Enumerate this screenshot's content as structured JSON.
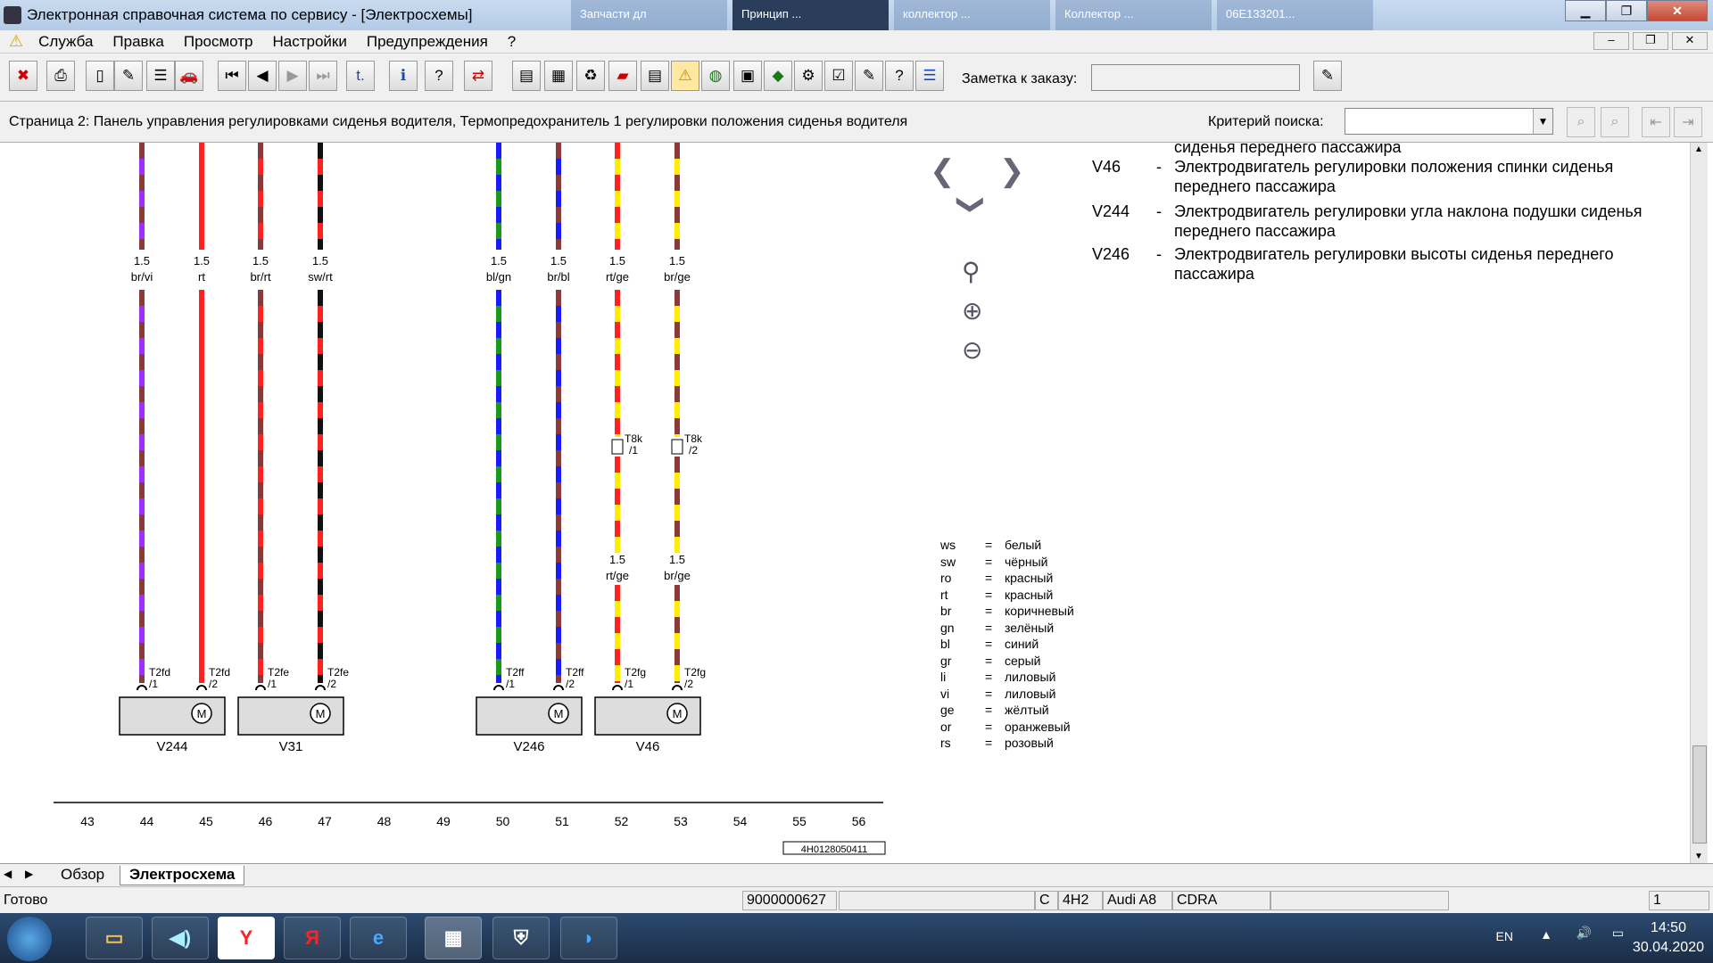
{
  "window": {
    "title": "Электронная справочная система по сервису - [Электросхемы]",
    "background_tabs": [
      "Запчасти дл",
      "Принцип ...",
      "коллектор ...",
      "Коллектор ...",
      "06E133201..."
    ]
  },
  "menu": [
    "Служба",
    "Правка",
    "Просмотр",
    "Настройки",
    "Предупреждения",
    "?"
  ],
  "toolbar": {
    "note_label": "Заметка к заказу:",
    "note_value": ""
  },
  "infobar": {
    "page_title": "Страница 2: Панель управления регулировками сиденья водителя, Термопредохранитель 1 регулировки положения сиденья водителя",
    "search_label": "Критерий поиска:",
    "search_value": ""
  },
  "legend_components": [
    {
      "code": "",
      "text": "сиденья переднего пассажира"
    },
    {
      "code": "V46",
      "text": "Электродвигатель регулировки положения спинки сиденья переднего пассажира"
    },
    {
      "code": "V244",
      "text": "Электродвигатель регулировки угла наклона подушки сиденья переднего пассажира"
    },
    {
      "code": "V246",
      "text": "Электродвигатель регулировки высоты сиденья переднего пассажира"
    }
  ],
  "color_codes": [
    {
      "abbr": "ws",
      "name": "белый"
    },
    {
      "abbr": "sw",
      "name": "чёрный"
    },
    {
      "abbr": "ro",
      "name": "красный"
    },
    {
      "abbr": "rt",
      "name": "красный"
    },
    {
      "abbr": "br",
      "name": "коричневый"
    },
    {
      "abbr": "gn",
      "name": "зелёный"
    },
    {
      "abbr": "bl",
      "name": "синий"
    },
    {
      "abbr": "gr",
      "name": "серый"
    },
    {
      "abbr": "li",
      "name": "лиловый"
    },
    {
      "abbr": "vi",
      "name": "лиловый"
    },
    {
      "abbr": "ge",
      "name": "жёлтый"
    },
    {
      "abbr": "or",
      "name": "оранжевый"
    },
    {
      "abbr": "rs",
      "name": "розовый"
    }
  ],
  "wires": [
    {
      "size": "1.5",
      "color": "br/vi",
      "conn": "T2fd",
      "pin": "/1",
      "c1": "#8b3a3a",
      "c2": "#9b30ff"
    },
    {
      "size": "1.5",
      "color": "rt",
      "conn": "T2fd",
      "pin": "/2",
      "c1": "#ff2020",
      "c2": "#ff2020"
    },
    {
      "size": "1.5",
      "color": "br/rt",
      "conn": "T2fe",
      "pin": "/1",
      "c1": "#8b3a3a",
      "c2": "#ff2020"
    },
    {
      "size": "1.5",
      "color": "sw/rt",
      "conn": "T2fe",
      "pin": "/2",
      "c1": "#111111",
      "c2": "#ff2020"
    },
    {
      "size": "1.5",
      "color": "bl/gn",
      "conn": "T2ff",
      "pin": "/1",
      "c1": "#1a1aff",
      "c2": "#1a9a1a"
    },
    {
      "size": "1.5",
      "color": "br/bl",
      "conn": "T2ff",
      "pin": "/2",
      "c1": "#8b3a3a",
      "c2": "#1a1aff"
    },
    {
      "size": "1.5",
      "color": "rt/ge",
      "conn": "T2fg",
      "pin": "/1",
      "c1": "#ff2020",
      "c2": "#ffee00",
      "mid_conn": "T8k",
      "mid_pin": "/1",
      "lower_size": "1.5",
      "lower_color": "rt/ge"
    },
    {
      "size": "1.5",
      "color": "br/ge",
      "conn": "T2fg",
      "pin": "/2",
      "c1": "#8b3a3a",
      "c2": "#ffee00",
      "mid_conn": "T8k",
      "mid_pin": "/2",
      "lower_size": "1.5",
      "lower_color": "br/ge"
    }
  ],
  "motors": [
    {
      "label": "V244",
      "symbol": "M"
    },
    {
      "label": "V31",
      "symbol": "M"
    },
    {
      "label": "V246",
      "symbol": "M"
    },
    {
      "label": "V46",
      "symbol": "M"
    }
  ],
  "scale_numbers": [
    "43",
    "44",
    "45",
    "46",
    "47",
    "48",
    "49",
    "50",
    "51",
    "52",
    "53",
    "54",
    "55",
    "56"
  ],
  "doc_number": "4H0128050411",
  "tabs": [
    "Обзор",
    "Электросхема"
  ],
  "status": {
    "ready": "Готово",
    "order": "9000000627",
    "c": "C",
    "model_code": "4H2",
    "model": "Audi A8",
    "engine": "CDRA",
    "page": "1"
  },
  "taskbar": {
    "lang": "EN",
    "time": "14:50",
    "date": "30.04.2020"
  }
}
